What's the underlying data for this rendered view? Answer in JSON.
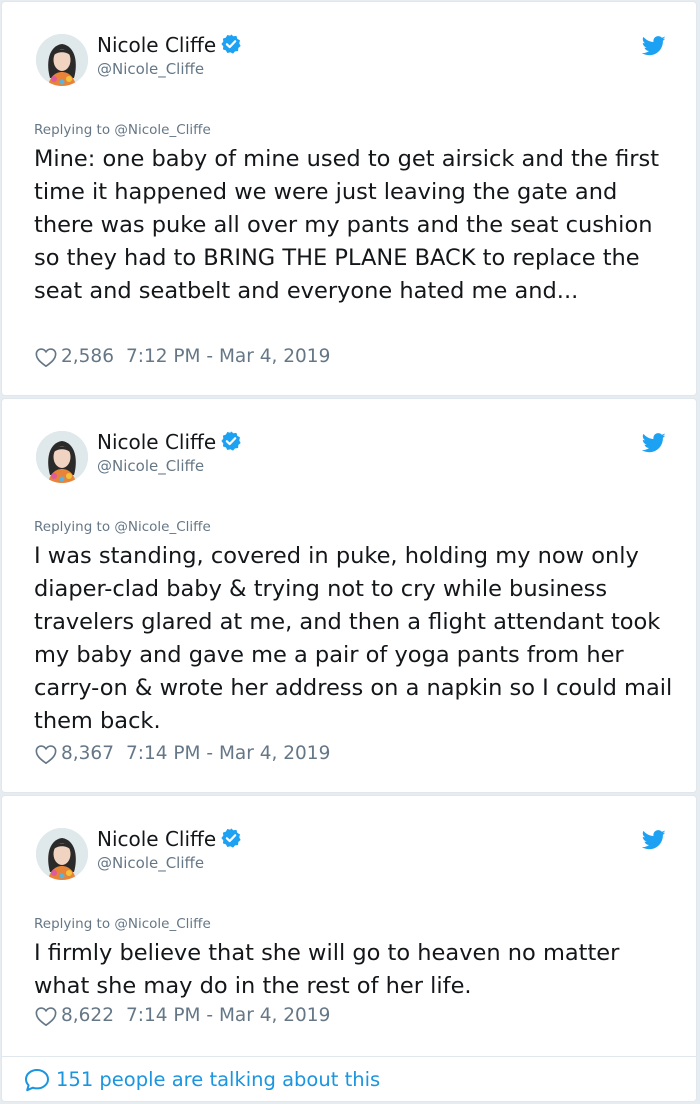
{
  "tweets": [
    {
      "author_name": "Nicole Cliffe",
      "author_handle": "@Nicole_Cliffe",
      "replying_to": "Replying to @Nicole_Cliffe",
      "text": "Mine: one baby of mine used to get airsick and the first time it happened we were just leaving the gate and there was puke all over my pants and the seat cushion so they had to BRING THE PLANE BACK to replace the seat and seatbelt and everyone hated me and...",
      "likes": "2,586",
      "timestamp": "7:12 PM - Mar 4, 2019"
    },
    {
      "author_name": "Nicole Cliffe",
      "author_handle": "@Nicole_Cliffe",
      "replying_to": "Replying to @Nicole_Cliffe",
      "text": "I was standing, covered in puke, holding my now only diaper-clad baby & trying not to cry while business travelers glared at me, and then a flight attendant took my baby and gave me a pair of yoga pants from her carry-on & wrote her address on a napkin so I could mail them back.",
      "likes": "8,367",
      "timestamp": "7:14 PM - Mar 4, 2019"
    },
    {
      "author_name": "Nicole Cliffe",
      "author_handle": "@Nicole_Cliffe",
      "replying_to": "Replying to @Nicole_Cliffe",
      "text": "I firmly believe that she will go to heaven no matter what she may do in the rest of her life.",
      "likes": "8,622",
      "timestamp": "7:14 PM - Mar 4, 2019"
    }
  ],
  "footer": {
    "label": "151 people are talking about this"
  },
  "icons": {
    "verified": "verified-badge-icon",
    "twitter": "twitter-bird-icon",
    "like": "heart-outline-icon",
    "conversation": "speech-bubble-icon"
  },
  "colors": {
    "twitter_blue": "#1da1f2",
    "link_blue": "#1b95e0",
    "secondary_text": "#657786",
    "primary_text": "#14171a"
  }
}
